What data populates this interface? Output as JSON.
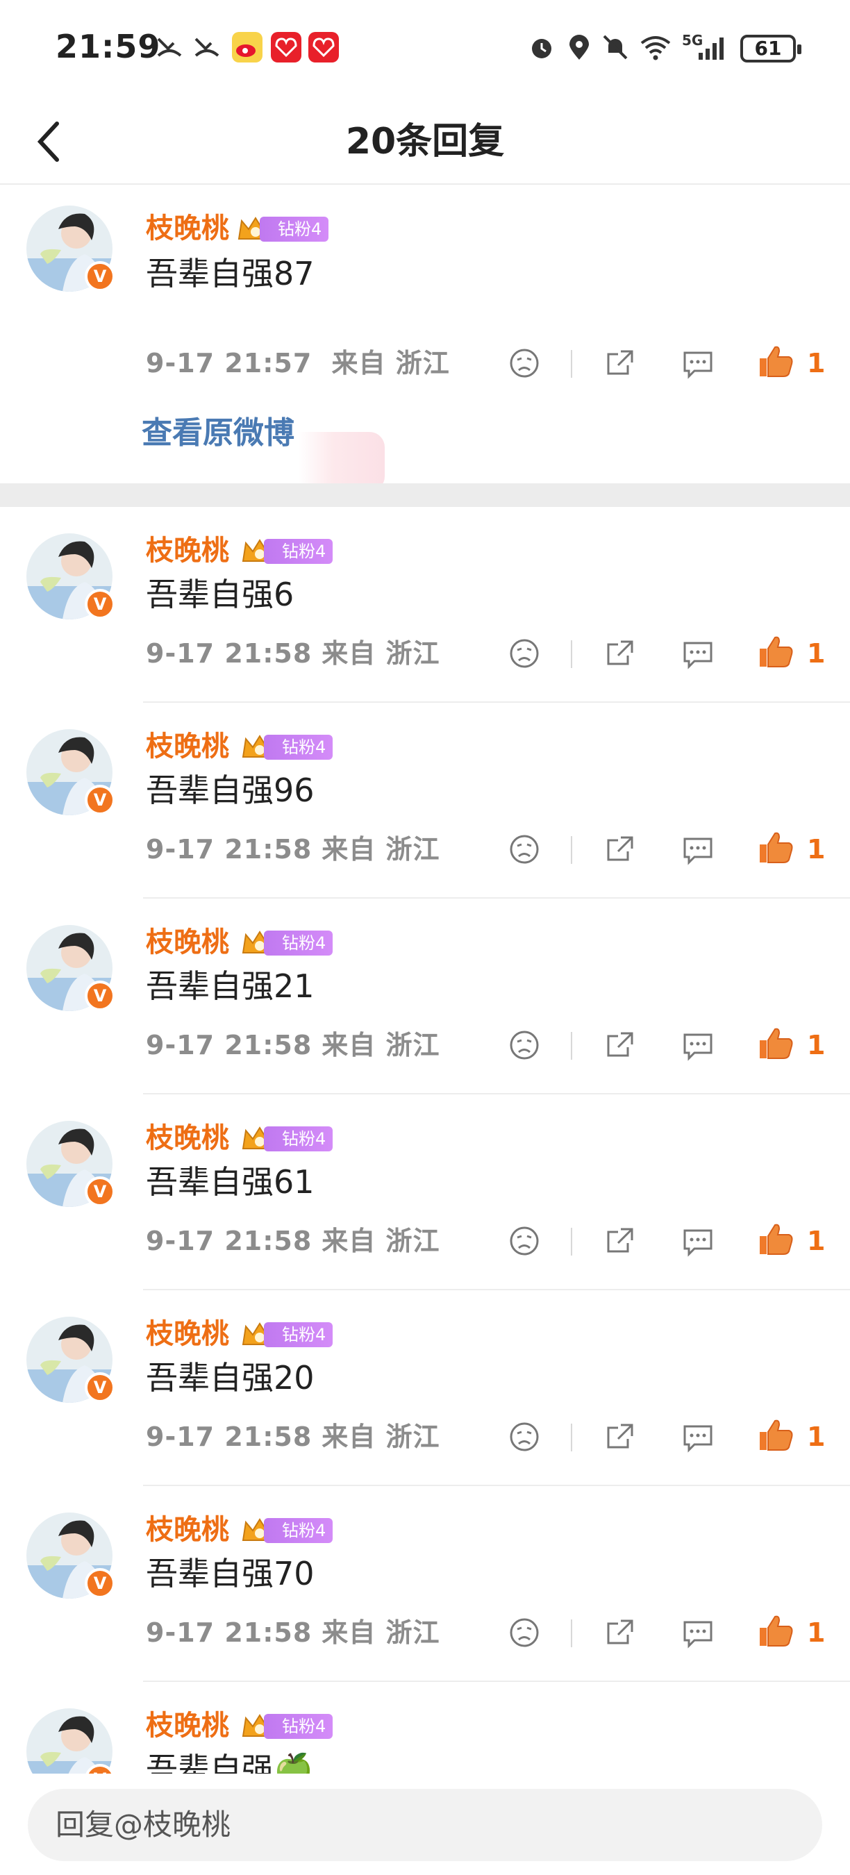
{
  "status_bar": {
    "time": "21:59",
    "network": "5G",
    "battery": "61",
    "icons": [
      "missed-call-icon",
      "missed-call-icon",
      "weibo-icon",
      "taobao-icon",
      "taobao-icon",
      "alarm-icon",
      "location-icon",
      "mute-icon",
      "wifi-icon",
      "signal-icon"
    ]
  },
  "header": {
    "title": "20条回复",
    "back_icon": "chevron-left-icon"
  },
  "root_comment": {
    "username": "枝晚桃",
    "fan_badge": "钻粉4",
    "text": "吾辈自强87",
    "time": "9-17 21:57",
    "location": "来自 浙江",
    "likes": "1",
    "view_original": "查看原微博"
  },
  "replies": [
    {
      "username": "枝晚桃",
      "fan_badge": "钻粉4",
      "text": "吾辈自强6",
      "time": "9-17 21:58",
      "location": "来自 浙江",
      "likes": "1"
    },
    {
      "username": "枝晚桃",
      "fan_badge": "钻粉4",
      "text": "吾辈自强96",
      "time": "9-17 21:58",
      "location": "来自 浙江",
      "likes": "1"
    },
    {
      "username": "枝晚桃",
      "fan_badge": "钻粉4",
      "text": "吾辈自强21",
      "time": "9-17 21:58",
      "location": "来自 浙江",
      "likes": "1"
    },
    {
      "username": "枝晚桃",
      "fan_badge": "钻粉4",
      "text": "吾辈自强61",
      "time": "9-17 21:58",
      "location": "来自 浙江",
      "likes": "1"
    },
    {
      "username": "枝晚桃",
      "fan_badge": "钻粉4",
      "text": "吾辈自强20",
      "time": "9-17 21:58",
      "location": "来自 浙江",
      "likes": "1"
    },
    {
      "username": "枝晚桃",
      "fan_badge": "钻粉4",
      "text": "吾辈自强70",
      "time": "9-17 21:58",
      "location": "来自 浙江",
      "likes": "1"
    },
    {
      "username": "枝晚桃",
      "fan_badge": "钻粉4",
      "text": "吾辈自强🍏"
    }
  ],
  "reply_bar": {
    "placeholder": "回复@枝晚桃"
  },
  "colors": {
    "accent": "#ee6e14",
    "link": "#4a7ab3",
    "meta": "#8c8c8c",
    "fan_badge": "#c97ff2"
  }
}
